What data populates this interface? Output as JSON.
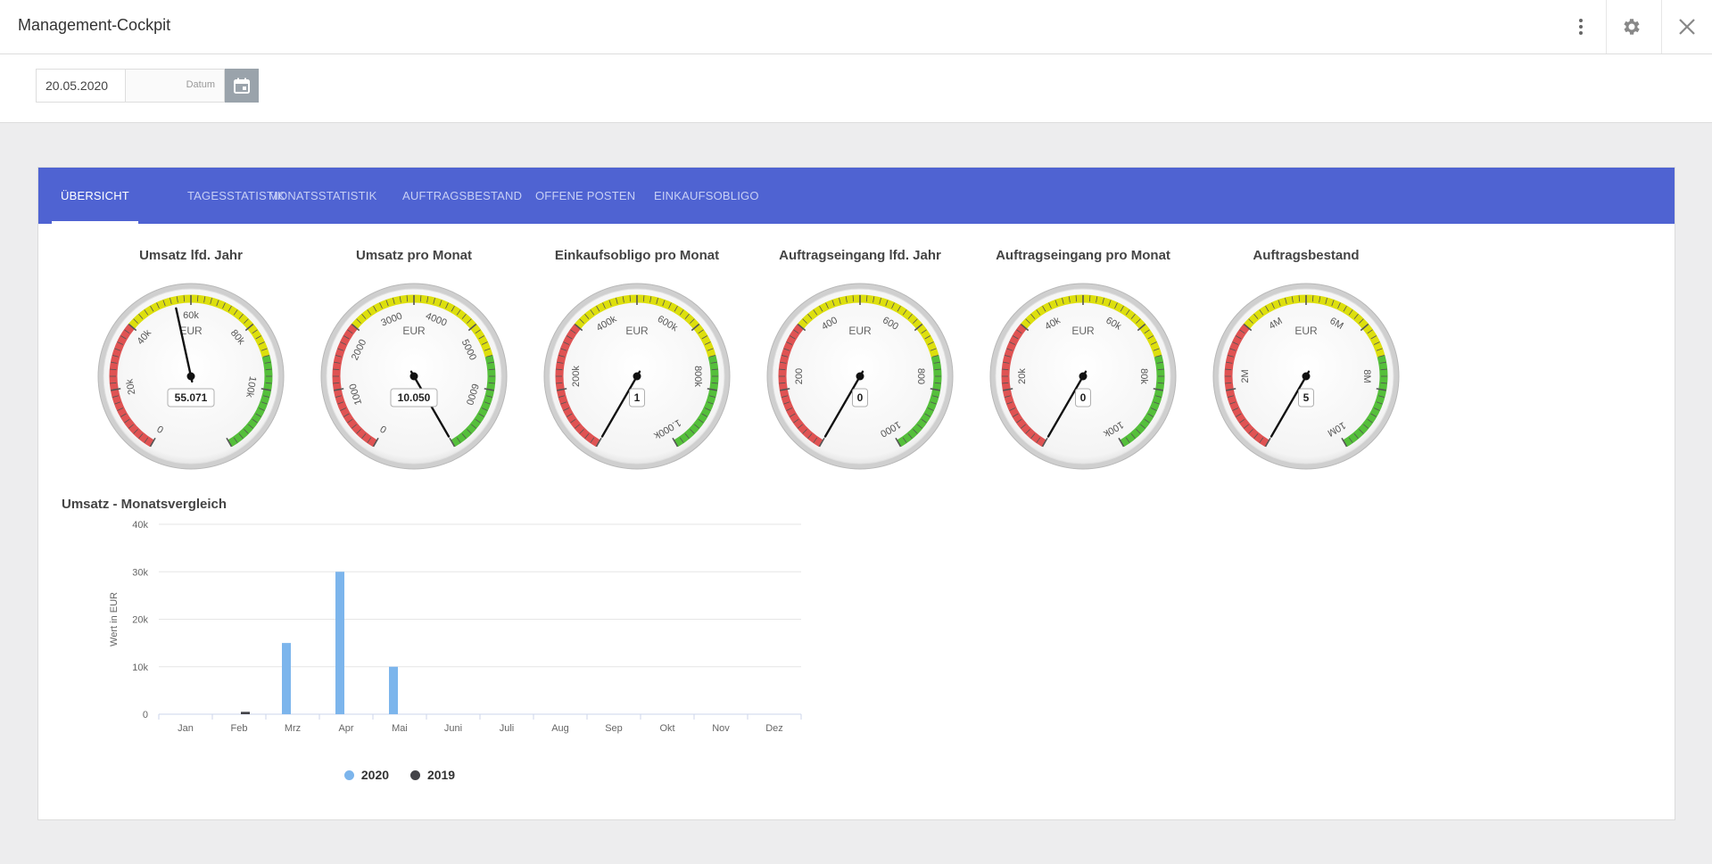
{
  "app": {
    "title": "Management-Cockpit"
  },
  "filter": {
    "date_value": "20.05.2020",
    "date_label": "Datum"
  },
  "tabs": [
    {
      "label": "ÜBERSICHT",
      "active": true
    },
    {
      "label": "TAGESSTATISTIK",
      "active": false
    },
    {
      "label": "MONATSSTATISTIK",
      "active": false
    },
    {
      "label": "AUFTRAGSBESTAND",
      "active": false
    },
    {
      "label": "OFFENE POSTEN",
      "active": false
    },
    {
      "label": "EINKAUFSOBLIGO",
      "active": false
    }
  ],
  "gauges": [
    {
      "title": "Umsatz lfd. Jahr",
      "unit": "EUR",
      "value": 55071,
      "display": "55.071",
      "min": 0,
      "max": 120000,
      "ticks": [
        "0",
        "20k",
        "40k",
        "60k",
        "80k",
        "100k"
      ],
      "tick_values": [
        0,
        20000,
        40000,
        60000,
        80000,
        100000
      ]
    },
    {
      "title": "Umsatz pro Monat",
      "unit": "EUR",
      "value": 10050,
      "display": "10.050",
      "min": 0,
      "max": 7000,
      "ticks": [
        "0",
        "1000",
        "2000",
        "3000",
        "4000",
        "5000",
        "6000"
      ],
      "tick_values": [
        0,
        1000,
        2000,
        3000,
        4000,
        5000,
        6000
      ]
    },
    {
      "title": "Einkaufsobligo pro Monat",
      "unit": "EUR",
      "value": 1,
      "display": "1",
      "min": 0,
      "max": 1000000,
      "ticks": [
        "200k",
        "400k",
        "600k",
        "800k",
        "1.000k"
      ],
      "tick_values": [
        200000,
        400000,
        600000,
        800000,
        1000000
      ]
    },
    {
      "title": "Auftragseingang lfd. Jahr",
      "unit": "EUR",
      "value": 0,
      "display": "0",
      "min": 0,
      "max": 1000,
      "ticks": [
        "200",
        "400",
        "600",
        "800",
        "1000"
      ],
      "tick_values": [
        200,
        400,
        600,
        800,
        1000
      ]
    },
    {
      "title": "Auftragseingang pro Monat",
      "unit": "EUR",
      "value": 0,
      "display": "0",
      "min": 0,
      "max": 100000,
      "ticks": [
        "20k",
        "40k",
        "60k",
        "80k",
        "100k"
      ],
      "tick_values": [
        20000,
        40000,
        60000,
        80000,
        100000
      ]
    },
    {
      "title": "Auftragsbestand",
      "unit": "EUR",
      "value": 5,
      "display": "5",
      "min": 0,
      "max": 10000000,
      "ticks": [
        "2M",
        "4M",
        "6M",
        "8M",
        "10M"
      ],
      "tick_values": [
        2000000,
        4000000,
        6000000,
        8000000,
        10000000
      ]
    }
  ],
  "chart_title": "Umsatz - Monatsvergleich",
  "chart_data": {
    "type": "bar",
    "title": "Umsatz - Monatsvergleich",
    "xlabel": "",
    "ylabel": "Wert in EUR",
    "ylim": [
      0,
      40000
    ],
    "yticks": [
      0,
      10000,
      20000,
      30000,
      40000
    ],
    "ytick_labels": [
      "0",
      "10k",
      "20k",
      "30k",
      "40k"
    ],
    "categories": [
      "Jan",
      "Feb",
      "Mrz",
      "Apr",
      "Mai",
      "Juni",
      "Juli",
      "Aug",
      "Sep",
      "Okt",
      "Nov",
      "Dez"
    ],
    "series": [
      {
        "name": "2020",
        "color": "#7cb5ec",
        "values": [
          0,
          0,
          15000,
          30000,
          10000,
          0,
          0,
          0,
          0,
          0,
          0,
          0
        ]
      },
      {
        "name": "2019",
        "color": "#434348",
        "values": [
          0,
          500,
          0,
          0,
          0,
          0,
          0,
          0,
          0,
          0,
          0,
          0
        ]
      }
    ],
    "grid": true,
    "legend": "bottom-center"
  },
  "colors": {
    "accent": "#4f63d2",
    "gauge_red": "#df5353",
    "gauge_yellow": "#dddf0d",
    "gauge_green": "#55bf3b"
  },
  "icons": {
    "menu": "kebab-menu-icon",
    "settings": "gear-icon",
    "close": "close-icon",
    "calendar": "calendar-icon"
  }
}
